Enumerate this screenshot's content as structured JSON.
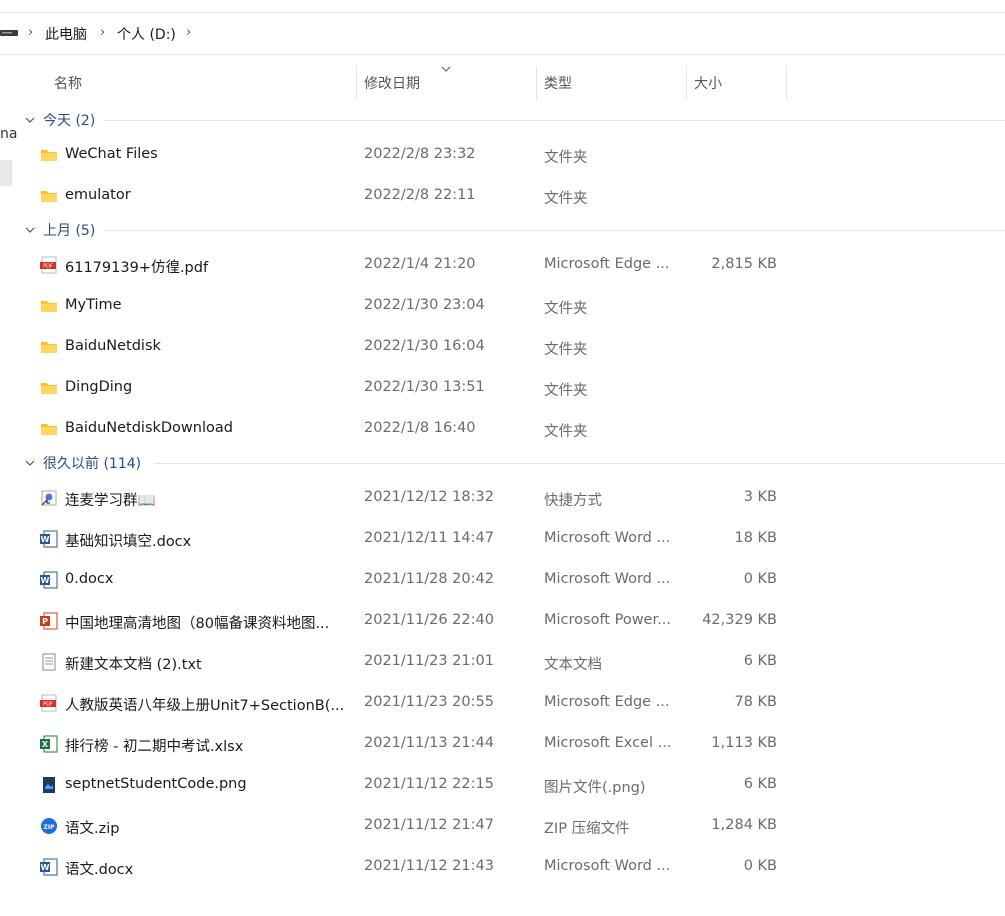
{
  "address_bar": {
    "crumbs": [
      "此电脑",
      "个人 (D:)"
    ],
    "separator": "›"
  },
  "left_edge_text": "na",
  "columns": {
    "name": "名称",
    "date": "修改日期",
    "type": "类型",
    "size": "大小"
  },
  "groups": [
    {
      "label": "今天 (2)",
      "items": [
        {
          "icon": "folder-icon",
          "name": "WeChat Files",
          "date": "2022/2/8 23:32",
          "type": "文件夹",
          "size": ""
        },
        {
          "icon": "folder-icon",
          "name": "emulator",
          "date": "2022/2/8 22:11",
          "type": "文件夹",
          "size": ""
        }
      ]
    },
    {
      "label": "上月 (5)",
      "items": [
        {
          "icon": "pdf-icon",
          "name": "61179139+仿徨.pdf",
          "date": "2022/1/4 21:20",
          "type": "Microsoft Edge ...",
          "size": "2,815 KB"
        },
        {
          "icon": "folder-icon",
          "name": "MyTime",
          "date": "2022/1/30 23:04",
          "type": "文件夹",
          "size": ""
        },
        {
          "icon": "folder-icon",
          "name": "BaiduNetdisk",
          "date": "2022/1/30 16:04",
          "type": "文件夹",
          "size": ""
        },
        {
          "icon": "folder-icon",
          "name": "DingDing",
          "date": "2022/1/30 13:51",
          "type": "文件夹",
          "size": ""
        },
        {
          "icon": "folder-icon",
          "name": "BaiduNetdiskDownload",
          "date": "2022/1/8 16:40",
          "type": "文件夹",
          "size": ""
        }
      ]
    },
    {
      "label": "很久以前 (114)",
      "items": [
        {
          "icon": "shortcut-icon",
          "name": "连麦学习群📖",
          "date": "2021/12/12 18:32",
          "type": "快捷方式",
          "size": "3 KB"
        },
        {
          "icon": "word-icon",
          "name": "基础知识填空.docx",
          "date": "2021/12/11 14:47",
          "type": "Microsoft Word ...",
          "size": "18 KB"
        },
        {
          "icon": "word-icon",
          "name": "0.docx",
          "date": "2021/11/28 20:42",
          "type": "Microsoft Word ...",
          "size": "0 KB"
        },
        {
          "icon": "powerpoint-icon",
          "name": "中国地理高清地图（80幅备课资料地图...",
          "date": "2021/11/26 22:40",
          "type": "Microsoft Power...",
          "size": "42,329 KB"
        },
        {
          "icon": "text-file-icon",
          "name": "新建文本文档 (2).txt",
          "date": "2021/11/23 21:01",
          "type": "文本文档",
          "size": "6 KB"
        },
        {
          "icon": "pdf-icon",
          "name": "人教版英语八年级上册Unit7+SectionB(...",
          "date": "2021/11/23 20:55",
          "type": "Microsoft Edge ...",
          "size": "78 KB"
        },
        {
          "icon": "excel-icon",
          "name": "排行榜 - 初二期中考试.xlsx",
          "date": "2021/11/13 21:44",
          "type": "Microsoft Excel ...",
          "size": "1,113 KB"
        },
        {
          "icon": "png-icon",
          "name": "septnetStudentCode.png",
          "date": "2021/11/12 22:15",
          "type": "图片文件(.png)",
          "size": "6 KB"
        },
        {
          "icon": "zip-icon",
          "name": "语文.zip",
          "date": "2021/11/12 21:47",
          "type": "ZIP 压缩文件",
          "size": "1,284 KB"
        },
        {
          "icon": "word-icon",
          "name": "语文.docx",
          "date": "2021/11/12 21:43",
          "type": "Microsoft Word ...",
          "size": "0 KB"
        }
      ]
    }
  ]
}
